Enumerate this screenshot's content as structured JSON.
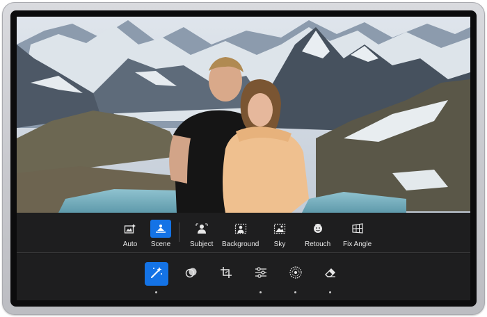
{
  "ai_toolbar": {
    "items": [
      {
        "label": "Auto",
        "icon": "auto-image-icon",
        "active": false
      },
      {
        "label": "Scene",
        "icon": "scene-icon",
        "active": true
      },
      {
        "label": "Subject",
        "icon": "subject-icon",
        "active": false
      },
      {
        "label": "Background",
        "icon": "background-icon",
        "active": false
      },
      {
        "label": "Sky",
        "icon": "sky-icon",
        "active": false
      },
      {
        "label": "Retouch",
        "icon": "retouch-face-icon",
        "active": false
      },
      {
        "label": "Fix Angle",
        "icon": "fix-angle-icon",
        "active": false
      }
    ]
  },
  "edit_toolbar": {
    "items": [
      {
        "icon": "magic-wand-icon",
        "active": true,
        "has_dot": true
      },
      {
        "icon": "color-mix-icon",
        "active": false,
        "has_dot": false
      },
      {
        "icon": "crop-icon",
        "active": false,
        "has_dot": false
      },
      {
        "icon": "adjust-sliders-icon",
        "active": false,
        "has_dot": true
      },
      {
        "icon": "vignette-icon",
        "active": false,
        "has_dot": true
      },
      {
        "icon": "eraser-icon",
        "active": false,
        "has_dot": true
      }
    ]
  },
  "colors": {
    "accent": "#1473e6",
    "panel": "#1e1e1f",
    "text": "#e8e8e8"
  }
}
